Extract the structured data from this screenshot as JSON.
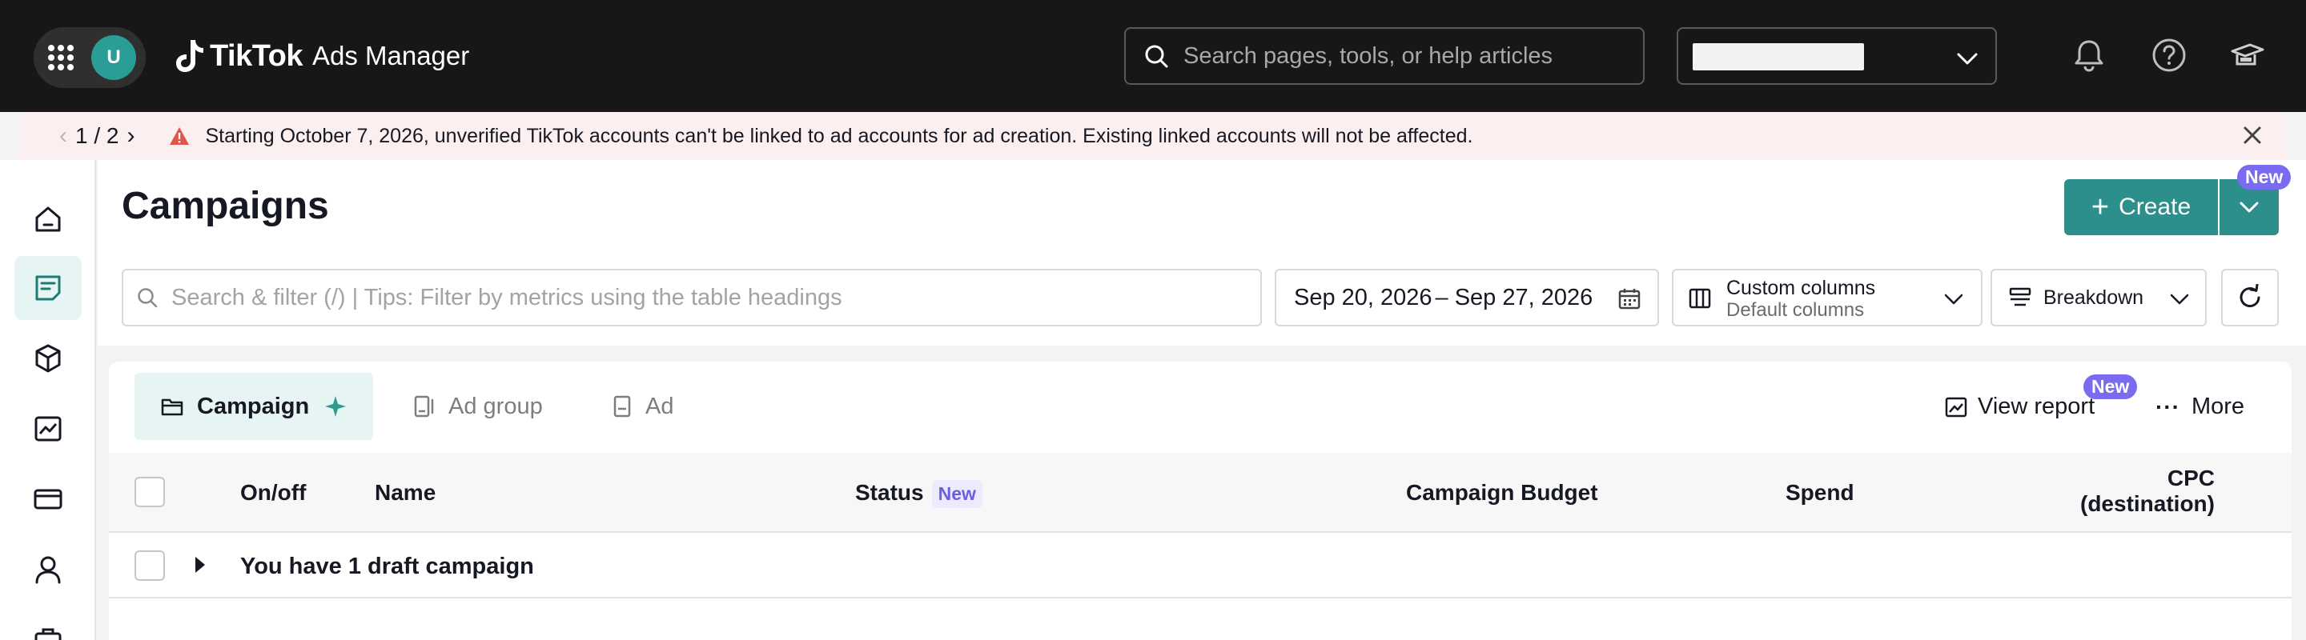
{
  "topbar": {
    "avatar_initial": "U",
    "brand_name": "TikTok",
    "product_name": "Ads Manager",
    "search_placeholder": "Search pages, tools, or help articles",
    "icons": [
      "apps-grid-icon",
      "bell-icon",
      "help-icon",
      "academy-icon"
    ]
  },
  "banner": {
    "pager": "1 / 2",
    "message": "Starting October 7, 2026, unverified TikTok accounts can't be linked to ad accounts for ad creation. Existing linked accounts will not be affected."
  },
  "sidebar": {
    "items": [
      "home",
      "campaigns",
      "assets",
      "reporting",
      "billing",
      "account",
      "tools"
    ],
    "active": "campaigns"
  },
  "header": {
    "title": "Campaigns",
    "create_label": "Create",
    "new_badge": "New",
    "filter_placeholder": "Search & filter (/) | Tips: Filter by metrics using the table headings",
    "date_start": "Sep 20, 2026",
    "date_sep": "–",
    "date_end": "Sep 27, 2026",
    "columns_label": "Custom columns",
    "columns_value": "Default columns",
    "breakdown_label": "Breakdown"
  },
  "tabs": {
    "campaign": "Campaign",
    "ad_group": "Ad group",
    "ad": "Ad",
    "view_report": "View report",
    "view_report_badge": "New",
    "more": "More"
  },
  "table": {
    "columns": {
      "onoff": "On/off",
      "name": "Name",
      "status": "Status",
      "status_badge": "New",
      "budget": "Campaign Budget",
      "spend": "Spend",
      "cpc_line1": "CPC",
      "cpc_line2": "(destination)"
    },
    "draft_row": "You have 1 draft campaign"
  },
  "colors": {
    "topbar_bg": "#171717",
    "accent": "#2d8f8b",
    "badge": "#7a6cf0",
    "banner_bg": "#fbf0ef"
  }
}
